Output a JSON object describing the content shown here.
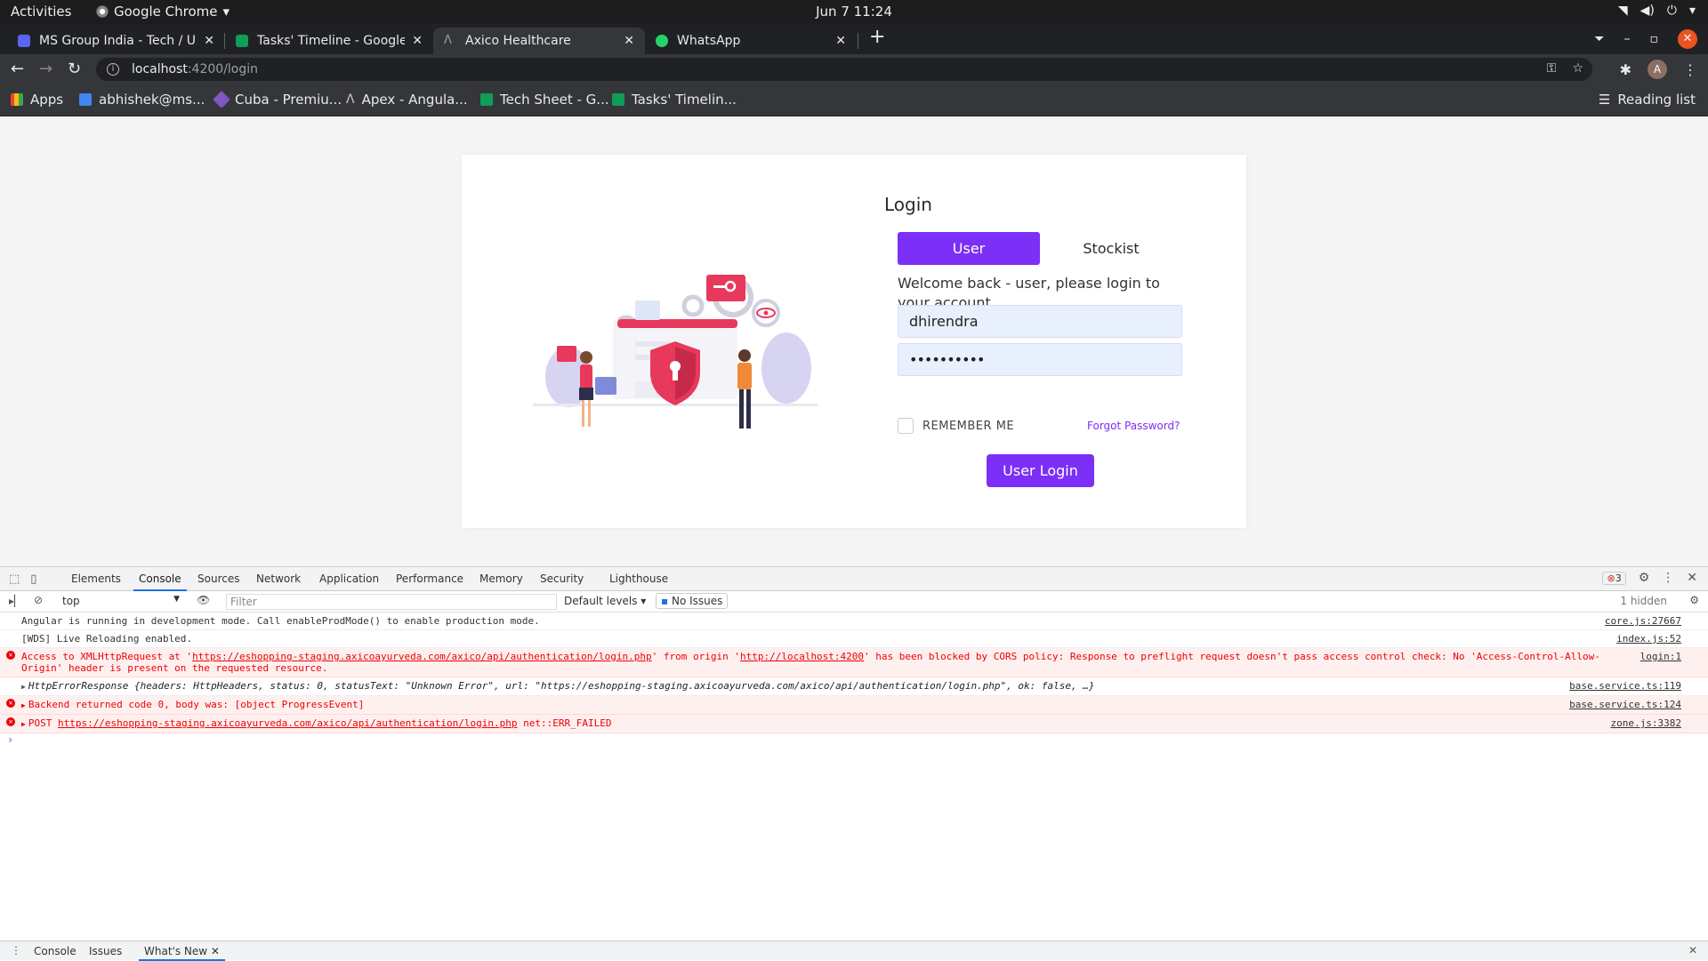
{
  "os_bar": {
    "activities": "Activities",
    "app_name": "Google Chrome",
    "clock": "Jun 7  11:24"
  },
  "tabs": [
    {
      "title": "MS Group India - Tech / Ur",
      "favicon_color": "#5865f2"
    },
    {
      "title": "Tasks' Timeline - Google S",
      "favicon_color": "#0f9d58"
    },
    {
      "title": "Axico Healthcare",
      "favicon_color": "#5f6368",
      "active": true
    },
    {
      "title": "WhatsApp",
      "favicon_color": "#25d366"
    }
  ],
  "omnibox": {
    "host": "localhost",
    "path": ":4200/login"
  },
  "bookmarks": [
    {
      "label": "Apps",
      "color": "#4285f4"
    },
    {
      "label": "abhishek@ms...",
      "color": "#4285f4"
    },
    {
      "label": "Cuba - Premiu...",
      "color": "#7e57c2"
    },
    {
      "label": "Apex - Angula...",
      "color": "#333333"
    },
    {
      "label": "Tech Sheet - G...",
      "color": "#0f9d58"
    },
    {
      "label": "Tasks' Timelin...",
      "color": "#0f9d58"
    }
  ],
  "reading_list": "Reading list",
  "login": {
    "title": "Login",
    "tab_user": "User",
    "tab_stockist": "Stockist",
    "welcome": "Welcome back - user, please login to your account.",
    "username": "dhirendra",
    "password_masked": "••••••••••",
    "remember": "REMEMBER ME",
    "forgot": "Forgot Password?",
    "submit": "User Login",
    "accent": "#7b2ff7"
  },
  "devtools": {
    "tabs": [
      "Elements",
      "Console",
      "Sources",
      "Network",
      "Application",
      "Performance",
      "Memory",
      "Security",
      "Lighthouse"
    ],
    "active_tab": "Console",
    "error_count": "3",
    "context": "top",
    "filter_placeholder": "Filter",
    "levels": "Default levels",
    "issues": "No Issues",
    "hidden": "1 hidden",
    "messages": [
      {
        "text": "Angular is running in development mode. Call enableProdMode() to enable production mode.",
        "source": "core.js:27667"
      },
      {
        "text": "[WDS] Live Reloading enabled.",
        "source": "index.js:52"
      },
      {
        "pre": "Access to XMLHttpRequest at '",
        "url": "https://eshopping-staging.axicoayurveda.com/axico/api/authentication/login.php",
        "mid": "' from origin '",
        "origin": "http://localhost:4200",
        "post": "' has been blocked by CORS policy: Response to preflight request doesn't pass access control check: No 'Access-Control-Allow-Origin' header is present on the requested resource.",
        "source": "login:1"
      },
      {
        "text": "HttpErrorResponse {headers: HttpHeaders, status: 0, statusText: \"Unknown Error\", url: \"https://eshopping-staging.axicoayurveda.com/axico/api/authentication/login.php\", ok: false, …}",
        "source": "base.service.ts:119"
      },
      {
        "text": "Backend returned code 0, body was: [object ProgressEvent]",
        "source": "base.service.ts:124"
      },
      {
        "pre": "POST ",
        "url": "https://eshopping-staging.axicoayurveda.com/axico/api/authentication/login.php",
        "post": " net::ERR_FAILED",
        "source": "zone.js:3382"
      }
    ],
    "drawer_tabs": [
      "Console",
      "Issues",
      "What's New"
    ]
  }
}
